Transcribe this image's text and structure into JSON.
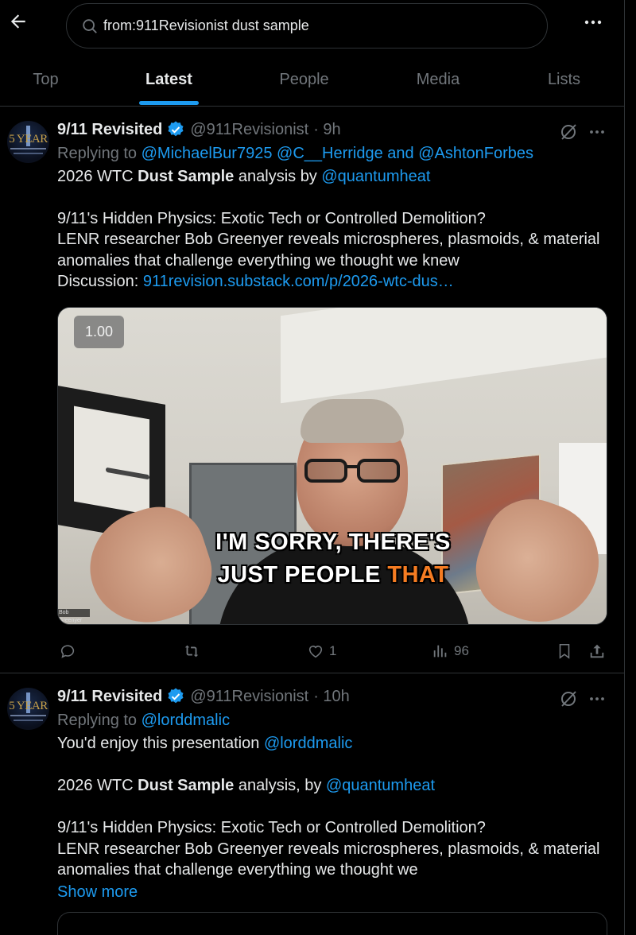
{
  "header": {
    "search_query": "from:911Revisionist dust sample"
  },
  "tabs": [
    {
      "label": "Top"
    },
    {
      "label": "Latest"
    },
    {
      "label": "People"
    },
    {
      "label": "Media"
    },
    {
      "label": "Lists"
    }
  ],
  "active_tab": "Latest",
  "accent_color": "#1d9bf0",
  "tweets": [
    {
      "avatar_text": "5 YEAR",
      "name": "9/11 Revisited",
      "handle": "@911Revisionist",
      "time": "· 9h",
      "replying_prefix": "Replying to",
      "replying_to": "@MichaelBur7925 @C__Herridge and @AshtonForbes",
      "text1_pre": "2026 WTC",
      "text1_bold": "Dust Sample",
      "text1_mid": "analysis by",
      "text1_mention": "@quantumheat",
      "text2": "9/11's Hidden Physics: Exotic Tech or Controlled Demolition?",
      "text3": "LENR researcher Bob Greenyer reveals microspheres, plasmoids, & material",
      "text4": "anomalies that challenge everything we thought we knew",
      "text5_label": "Discussion:",
      "text5_link": "911revision.substack.com/p/2026-wtc-dus…",
      "video": {
        "speed": "1.00",
        "caption_line1": "I'M SORRY, THERE'S",
        "caption_line2_pre": "JUST PEOPLE",
        "caption_line2_hl": "THAT",
        "name_tag": "Bob Greenyer",
        "highlight_color": "#f57c22"
      },
      "stats": {
        "replies": "",
        "reposts": "",
        "likes": "1",
        "views": "96"
      }
    },
    {
      "avatar_text": "5 YEAR",
      "name": "9/11 Revisited",
      "handle": "@911Revisionist",
      "time": "· 10h",
      "replying_prefix": "Replying to",
      "replying_to": "@lorddmalic",
      "text0_pre": "You'd enjoy this presentation",
      "text0_mention": "@lorddmalic",
      "text1_pre": "2026 WTC",
      "text1_bold": "Dust Sample",
      "text1_mid": "analysis, by",
      "text1_mention": "@quantumheat",
      "text2": "9/11's Hidden Physics: Exotic Tech or Controlled Demolition?",
      "text3": "LENR researcher Bob Greenyer reveals microspheres, plasmoids, & material",
      "text4": "anomalies that challenge everything we thought we",
      "show_more": "Show more"
    }
  ]
}
